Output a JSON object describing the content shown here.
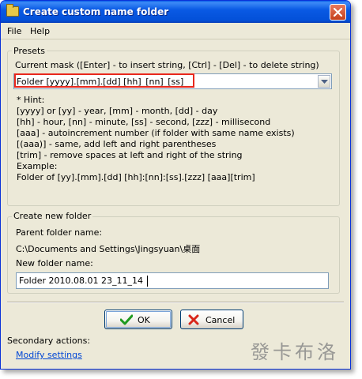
{
  "window": {
    "title": "Create custom name folder"
  },
  "menu": {
    "file": "File",
    "help": "Help"
  },
  "presets": {
    "group_label": "Presets",
    "mask_label": "Current mask  ([Enter] - to insert string, [Ctrl] - [Del] - to delete string)",
    "mask_value": "Folder [yyyy].[mm].[dd] [hh]_[nn]_[ss]",
    "hint_lines": [
      "* Hint:",
      "[yyyy] or [yy] - year, [mm] - month, [dd] - day",
      "[hh] - hour, [nn] - minute, [ss] - second, [zzz] - millisecond",
      "[aaa] - autoincrement number (if folder with same name exists)",
      "[(aaa)] - same, add left and right parentheses",
      "[trim] - remove spaces at left and right of the string",
      "Example:",
      "Folder of [yy].[mm].[dd] [hh]:[nn]:[ss].[zzz] [aaa][trim]"
    ]
  },
  "new_folder": {
    "group_label": "Create new folder",
    "parent_label": "Parent folder name:",
    "parent_value": "C:\\Documents and Settings\\Jingsyuan\\桌面",
    "name_label": "New folder name:",
    "name_value": "Folder 2010.08.01 23_11_14"
  },
  "buttons": {
    "ok": "OK",
    "cancel": "Cancel"
  },
  "footer": {
    "secondary_label": "Secondary actions:",
    "modify_link": "Modify settings",
    "watermark": "發卡布洛"
  },
  "colors": {
    "highlight_border": "#e8271c",
    "link": "#0046d5"
  }
}
